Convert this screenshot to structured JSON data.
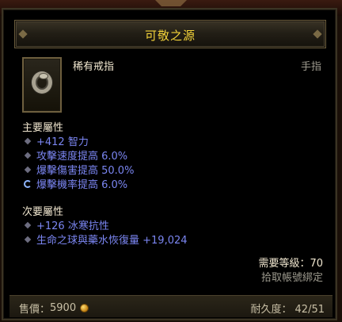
{
  "item": {
    "name": "可敬之源",
    "type": "稀有戒指",
    "slot": "手指",
    "icon": "ring-icon"
  },
  "primary": {
    "label": "主要屬性",
    "stats": [
      "+412 智力",
      "攻擊速度提高 6.0%",
      "爆擊傷害提高 50.0%",
      "爆擊機率提高 6.0%"
    ]
  },
  "secondary": {
    "label": "次要屬性",
    "stats": [
      "+126 冰寒抗性",
      "生命之球與藥水恢復量 +19,024"
    ]
  },
  "requirements": {
    "level": "需要等級：70",
    "bind": "拾取帳號綁定"
  },
  "footer": {
    "sell_label": "售價：",
    "sell_value": "5900",
    "durability_label": "耐久度：",
    "durability_value": "42/51"
  },
  "colors": {
    "title": "#f3d33a",
    "stat_blue": "#7b86f2",
    "white_text": "#f0e6cf",
    "gray_text": "#9d9a8e"
  }
}
